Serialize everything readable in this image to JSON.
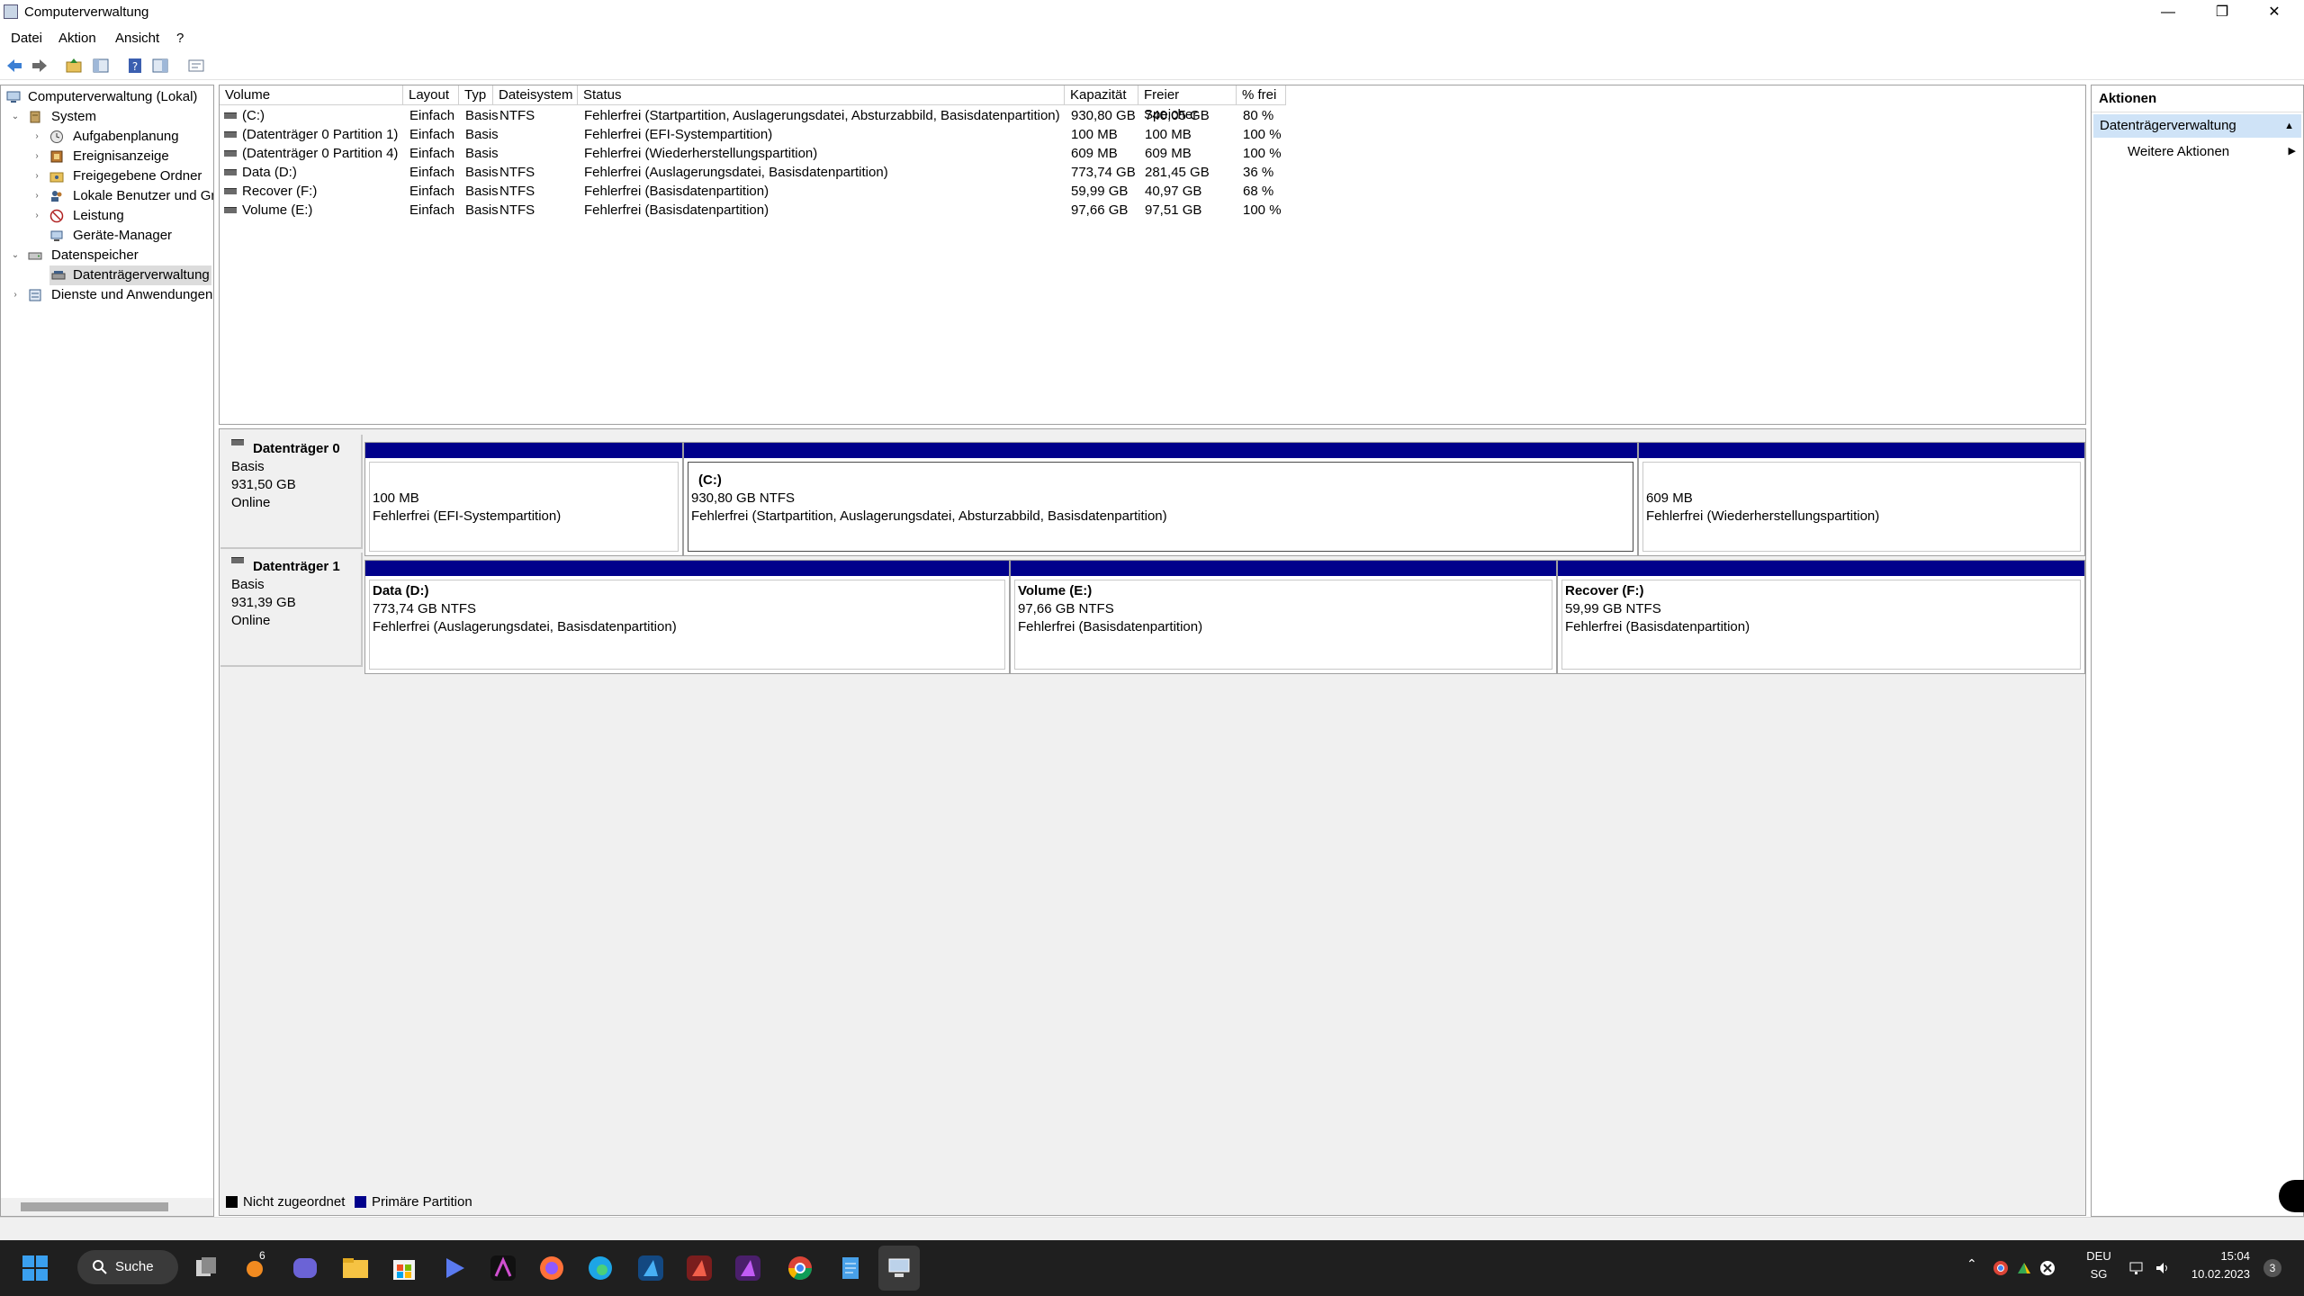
{
  "window": {
    "title": "Computerverwaltung",
    "controls": {
      "minimize": "—",
      "restore": "❐",
      "close": "✕"
    }
  },
  "menu": [
    "Datei",
    "Aktion",
    "Ansicht",
    "?"
  ],
  "tree": {
    "root": "Computerverwaltung (Lokal)",
    "system": "System",
    "system_children": [
      "Aufgabenplanung",
      "Ereignisanzeige",
      "Freigegebene Ordner",
      "Lokale Benutzer und Gr",
      "Leistung",
      "Geräte-Manager"
    ],
    "storage": "Datenspeicher",
    "storage_children": [
      "Datenträgerverwaltung"
    ],
    "services": "Dienste und Anwendungen"
  },
  "volumes": {
    "headers": [
      "Volume",
      "Layout",
      "Typ",
      "Dateisystem",
      "Status",
      "Kapazität",
      "Freier Speicher",
      "% frei"
    ],
    "rows": [
      [
        "(C:)",
        "Einfach",
        "Basis",
        "NTFS",
        "Fehlerfrei (Startpartition, Auslagerungsdatei, Absturzabbild, Basisdatenpartition)",
        "930,80 GB",
        "740,05 GB",
        "80 %"
      ],
      [
        "(Datenträger 0 Partition 1)",
        "Einfach",
        "Basis",
        "",
        "Fehlerfrei (EFI-Systempartition)",
        "100 MB",
        "100 MB",
        "100 %"
      ],
      [
        "(Datenträger 0 Partition 4)",
        "Einfach",
        "Basis",
        "",
        "Fehlerfrei (Wiederherstellungspartition)",
        "609 MB",
        "609 MB",
        "100 %"
      ],
      [
        "Data (D:)",
        "Einfach",
        "Basis",
        "NTFS",
        "Fehlerfrei (Auslagerungsdatei, Basisdatenpartition)",
        "773,74 GB",
        "281,45 GB",
        "36 %"
      ],
      [
        "Recover (F:)",
        "Einfach",
        "Basis",
        "NTFS",
        "Fehlerfrei (Basisdatenpartition)",
        "59,99 GB",
        "40,97 GB",
        "68 %"
      ],
      [
        "Volume (E:)",
        "Einfach",
        "Basis",
        "NTFS",
        "Fehlerfrei (Basisdatenpartition)",
        "97,66 GB",
        "97,51 GB",
        "100 %"
      ]
    ]
  },
  "disks": [
    {
      "name": "Datenträger 0",
      "type": "Basis",
      "size": "931,50 GB",
      "state": "Online",
      "partitions": [
        {
          "title": "",
          "size": "100 MB",
          "status": "Fehlerfrei (EFI-Systempartition)"
        },
        {
          "title": "(C:)",
          "size": "930,80 GB NTFS",
          "status": "Fehlerfrei (Startpartition, Auslagerungsdatei, Absturzabbild, Basisdatenpartition)"
        },
        {
          "title": "",
          "size": "609 MB",
          "status": "Fehlerfrei (Wiederherstellungspartition)"
        }
      ]
    },
    {
      "name": "Datenträger 1",
      "type": "Basis",
      "size": "931,39 GB",
      "state": "Online",
      "partitions": [
        {
          "title": "Data  (D:)",
          "size": "773,74 GB NTFS",
          "status": "Fehlerfrei (Auslagerungsdatei, Basisdatenpartition)"
        },
        {
          "title": "Volume  (E:)",
          "size": "97,66 GB NTFS",
          "status": "Fehlerfrei (Basisdatenpartition)"
        },
        {
          "title": "Recover  (F:)",
          "size": "59,99 GB NTFS",
          "status": "Fehlerfrei (Basisdatenpartition)"
        }
      ]
    }
  ],
  "legend": {
    "unallocated": "Nicht zugeordnet",
    "primary": "Primäre Partition"
  },
  "colors": {
    "primary_partition": "#00008b",
    "unallocated": "#000000",
    "selection": "#cfe3f7"
  },
  "actions": {
    "title": "Aktionen",
    "section": "Datenträgerverwaltung",
    "more": "Weitere Aktionen"
  },
  "taskbar": {
    "search": "Suche",
    "badge": "6",
    "lang": "DEU",
    "region": "SG",
    "time": "15:04",
    "date": "10.02.2023",
    "notification_count": "3"
  }
}
